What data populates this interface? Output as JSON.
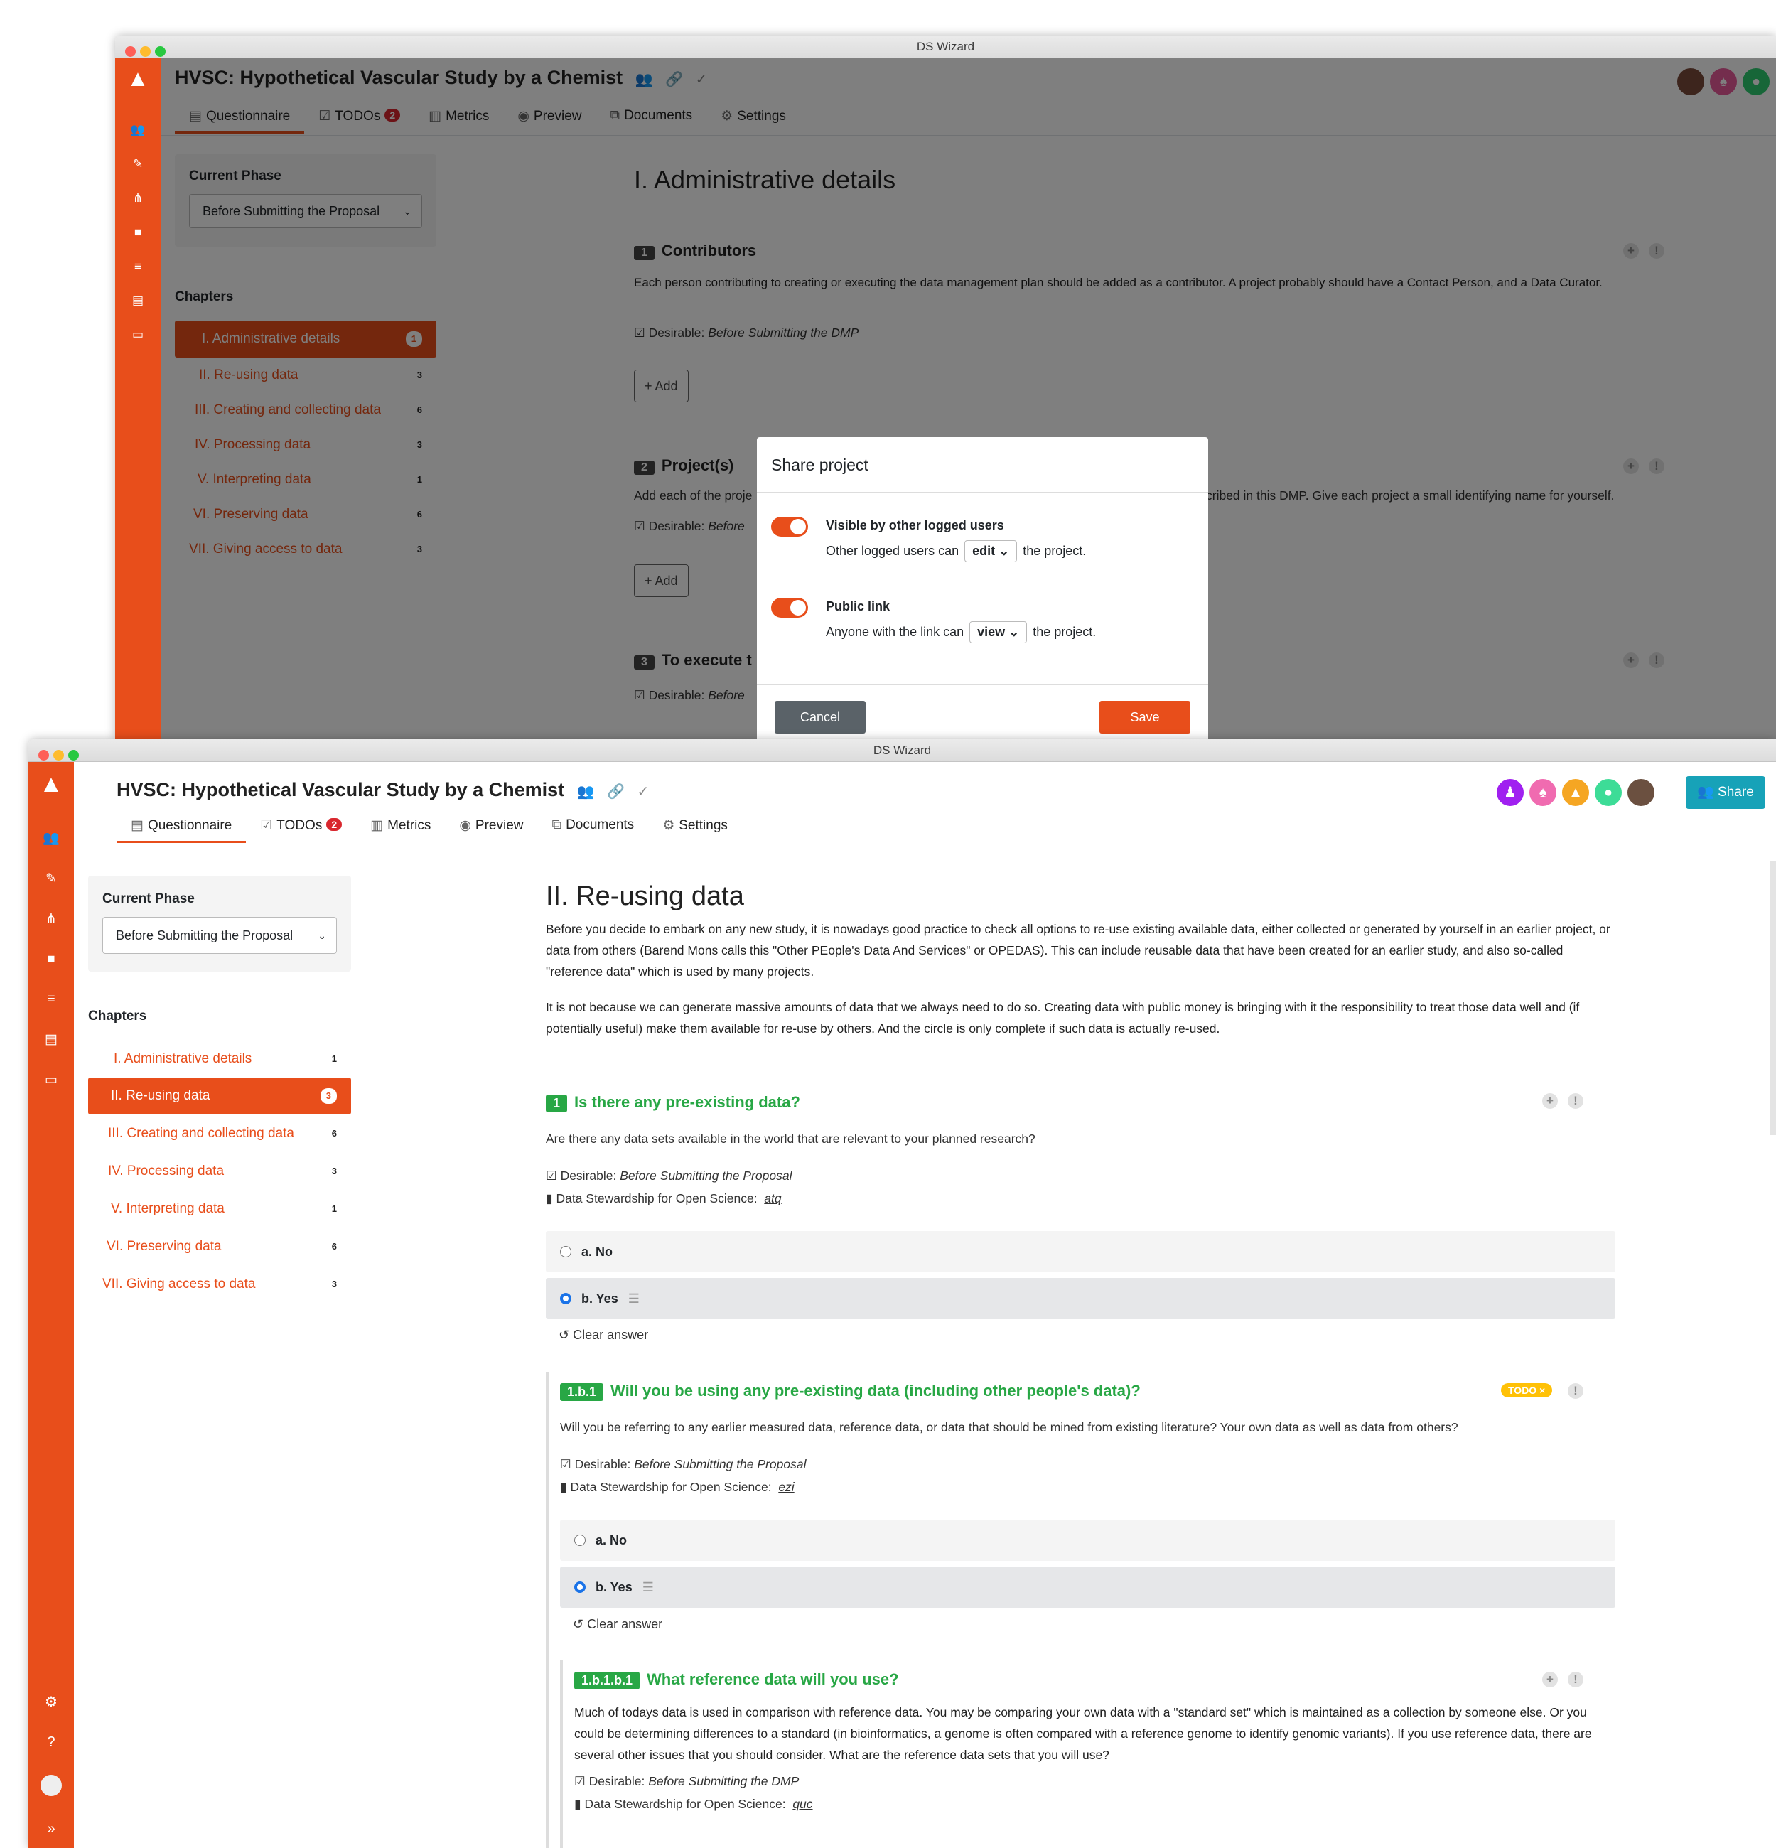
{
  "window": {
    "title": "DS Wizard"
  },
  "project": {
    "title": "HVSC: Hypothetical Vascular Study by a Chemist"
  },
  "nav": {
    "tabs": [
      {
        "label": "Questionnaire",
        "icon": "list-icon"
      },
      {
        "label": "TODOs",
        "icon": "checkbox-icon",
        "badge": "2"
      },
      {
        "label": "Metrics",
        "icon": "chart-icon"
      },
      {
        "label": "Preview",
        "icon": "eye-icon"
      },
      {
        "label": "Documents",
        "icon": "copy-icon"
      },
      {
        "label": "Settings",
        "icon": "gears-icon"
      }
    ]
  },
  "share_label": "Share",
  "phase": {
    "label": "Current Phase",
    "value": "Before Submitting the Proposal"
  },
  "chapters": {
    "label": "Chapters",
    "items": [
      {
        "label": "I. Administrative details",
        "count": "1"
      },
      {
        "label": "II. Re-using data",
        "count": "3"
      },
      {
        "label": "III. Creating and collecting data",
        "count": "6"
      },
      {
        "label": "IV. Processing data",
        "count": "3"
      },
      {
        "label": "V. Interpreting data",
        "count": "1"
      },
      {
        "label": "VI. Preserving data",
        "count": "6"
      },
      {
        "label": "VII. Giving access to data",
        "count": "3"
      }
    ]
  },
  "back": {
    "heading": "I. Administrative details",
    "q1": {
      "num": "1",
      "title": "Contributors",
      "text": "Each person contributing to creating or executing the data management plan should be added as a contributor. A project probably should have a Contact Person, and a Data Curator.",
      "desirable": "Desirable:",
      "desirable_value": "Before Submitting the DMP",
      "add": "Add"
    },
    "q2": {
      "num": "2",
      "title": "Project(s)",
      "text_left": "Add each of the proje",
      "text_right": "cribed in this DMP. Give each project a small identifying name for yourself.",
      "desirable": "Desirable:",
      "desirable_value": "Before",
      "add": "Add"
    },
    "q3": {
      "num": "3",
      "title": "To execute t",
      "desirable": "Desirable:",
      "desirable_value": "Before"
    }
  },
  "modal": {
    "title": "Share project",
    "visible_label": "Visible by other logged users",
    "visible_sentence_pre": "Other logged users can",
    "visible_select": "edit",
    "visible_sentence_post": "the project.",
    "public_label": "Public link",
    "public_sentence_pre": "Anyone with the link can",
    "public_select": "view",
    "public_sentence_post": "the project.",
    "cancel": "Cancel",
    "save": "Save"
  },
  "front": {
    "heading": "II. Re-using data",
    "intro1": "Before you decide to embark on any new study, it is nowadays good practice to check all options to re-use existing available data, either collected or generated by yourself in an earlier project, or data from others (Barend Mons calls this \"Other PEople's Data And Services\" or OPEDAS). This can include reusable data that have been created for an earlier study, and also so-called \"reference data\" which is used by many projects.",
    "intro2": "It is not because we can generate massive amounts of data that we always need to do so. Creating data with public money is bringing with it the responsibility to treat those data well and (if potentially useful) make them available for re-use by others. And the circle is only complete if such data is actually re-used.",
    "q1": {
      "num": "1",
      "title": "Is there any pre-existing data?",
      "text": "Are there any data sets available in the world that are relevant to your planned research?",
      "desirable": "Desirable:",
      "desirable_value": "Before Submitting the Proposal",
      "book": "Data Stewardship for Open Science:",
      "book_ref": "atq",
      "a": "a. No",
      "b": "b. Yes",
      "clear": "Clear answer"
    },
    "q2": {
      "num": "1.b.1",
      "title": "Will you be using any pre-existing data (including other people's data)?",
      "todo": "TODO ×",
      "text": "Will you be referring to any earlier measured data, reference data, or data that should be mined from existing literature? Your own data as well as data from others?",
      "desirable": "Desirable:",
      "desirable_value": "Before Submitting the Proposal",
      "book": "Data Stewardship for Open Science:",
      "book_ref": "ezi",
      "a": "a. No",
      "b": "b. Yes",
      "clear": "Clear answer"
    },
    "q3": {
      "num": "1.b.1.b.1",
      "title": "What reference data will you use?",
      "text": "Much of todays data is used in comparison with reference data. You may be comparing your own data with a \"standard set\" which is maintained as a collection by someone else. Or you could be determining differences to a standard (in bioinformatics, a genome is often compared with a reference genome to identify genomic variants). If you use reference data, there are several other issues that you should consider. What are the reference data sets that you will use?",
      "desirable": "Desirable:",
      "desirable_value": "Before Submitting the DMP",
      "book": "Data Stewardship for Open Science:",
      "book_ref": "quc"
    }
  },
  "colors": {
    "brand": "#e84e1b",
    "success": "#28a745",
    "info": "#17a2b8",
    "warning": "#ffc107",
    "danger": "#d9272e"
  }
}
